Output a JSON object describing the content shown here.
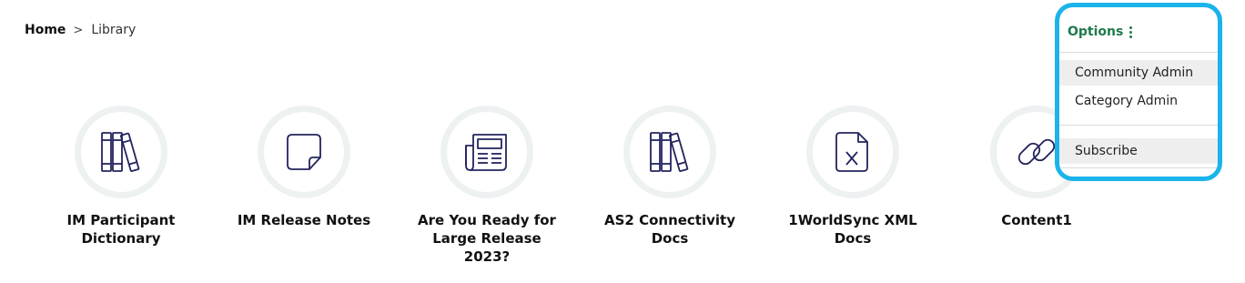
{
  "breadcrumb": {
    "home": "Home",
    "separator": ">",
    "current": "Library"
  },
  "tiles": [
    {
      "label": "IM Participant Dictionary",
      "icon": "books-icon"
    },
    {
      "label": "IM Release Notes",
      "icon": "sticky-note-icon"
    },
    {
      "label": "Are You Ready for Large Release 2023?",
      "icon": "newspaper-icon"
    },
    {
      "label": "AS2 Connectivity Docs",
      "icon": "books-icon"
    },
    {
      "label": "1WorldSync XML Docs",
      "icon": "xml-file-icon"
    },
    {
      "label": "Content1",
      "icon": "link-icon"
    }
  ],
  "options": {
    "label": "Options",
    "items": [
      {
        "label": "Community Admin"
      },
      {
        "label": "Category Admin"
      },
      {
        "label": "Subscribe"
      }
    ]
  },
  "colors": {
    "accent_green": "#1f7a4b",
    "highlight_border": "#1bb3ea",
    "icon_stroke": "#23245e",
    "circle_ring": "#eef1f1"
  }
}
